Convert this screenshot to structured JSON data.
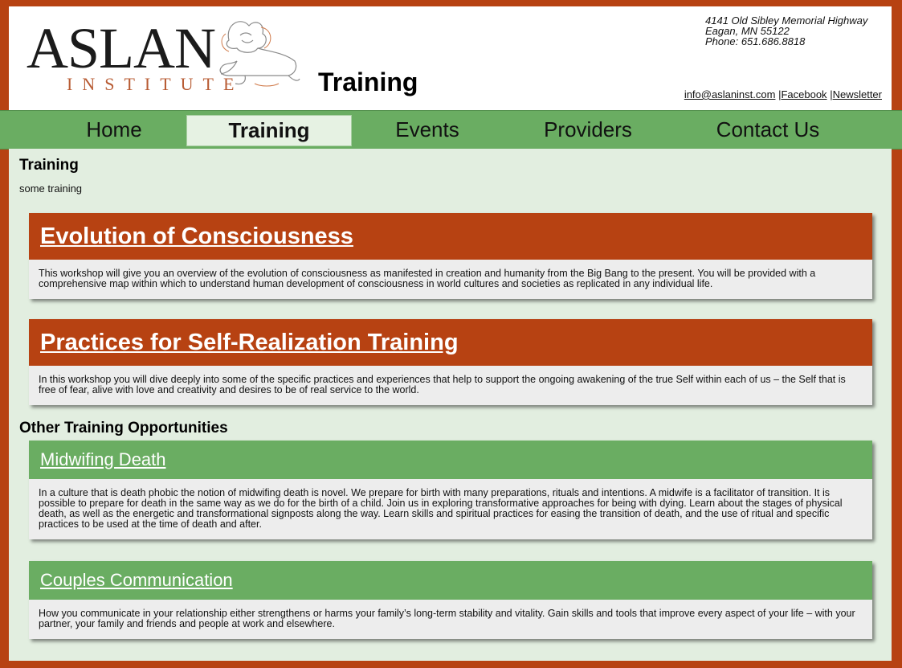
{
  "brand": {
    "name": "ASLAN",
    "subtitle": "INSTITUTE"
  },
  "header": {
    "page_title": "Training",
    "address": [
      "4141 Old Sibley Memorial Highway",
      "Eagan, MN 55122",
      "Phone: 651.686.8818"
    ],
    "links": {
      "email": "info@aslaninst.com",
      "facebook": "Facebook",
      "newsletter": "Newsletter"
    }
  },
  "nav": {
    "items": [
      "Home",
      "Training",
      "Events",
      "Providers",
      "Contact Us"
    ],
    "active": "Training"
  },
  "content": {
    "title": "Training",
    "intro": "some training",
    "featured": [
      {
        "title": "Evolution of Consciousness",
        "body": "This workshop will give you an overview of the evolution of consciousness as manifested in creation and humanity from the Big Bang to the present. You will be provided with a comprehensive map within which to understand human development of consciousness in world cultures and societies as replicated in any individual life."
      },
      {
        "title": "Practices for Self-Realization Training",
        "body": "In this workshop you will dive deeply into some of the specific practices and experiences that help to support the ongoing awakening of the true Self within each of us – the Self that is free of fear, alive with love and creativity and desires to be of real service to the world."
      }
    ],
    "other_heading": "Other Training Opportunities",
    "other": [
      {
        "title": "Midwifing Death",
        "body": "In a culture that is death phobic the notion of midwifing death is novel. We prepare for birth with many preparations, rituals and intentions. A midwife is a facilitator of transition. It is possible to prepare for death in the same way as we do for the birth of a child. Join us in exploring transformative approaches for being with dying. Learn about the stages of physical death, as well as the energetic and transformational signposts along the way. Learn skills and spiritual practices for easing the transition of death, and the use of ritual and specific practices to be used at the time of death and after."
      },
      {
        "title": "Couples Communication",
        "body": "How you communicate in your relationship either strengthens or harms your family’s long-term stability and vitality. Gain skills and tools that improve every aspect of your life – with your partner, your family and friends and people at work and elsewhere."
      }
    ]
  },
  "colors": {
    "border": "#b74212",
    "nav_green": "#6aad62",
    "content_bg": "#e2eee0",
    "card_red": "#b74212"
  }
}
